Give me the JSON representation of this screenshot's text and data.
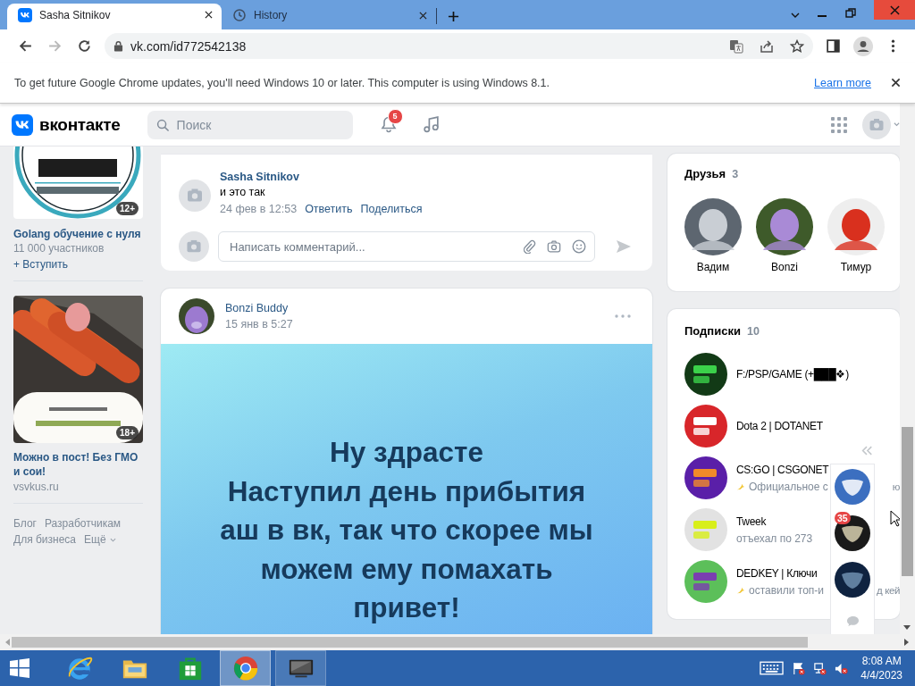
{
  "browser": {
    "tabs": [
      {
        "title": "Sasha Sitnikov",
        "selected": true
      },
      {
        "title": "History",
        "selected": false
      }
    ],
    "forward_disabled": true,
    "url": "vk.com/id772542138"
  },
  "infobar": {
    "message": "To get future Google Chrome updates, you'll need Windows 10 or later. This computer is using Windows 8.1.",
    "link": "Learn more"
  },
  "vk_header": {
    "logo": "вконтакте",
    "search": {
      "placeholder": "Поиск"
    },
    "notifications_badge": "5"
  },
  "left": {
    "group": {
      "age": "12+",
      "name": "Golang обучение с нуля",
      "members": "11 000 участников",
      "join": "+ Вступить"
    },
    "ad": {
      "age": "18+",
      "title": "Можно в пост! Без ГМО и сои!",
      "domain": "vsvkus.ru"
    },
    "footer_links": [
      "Блог",
      "Разработчикам",
      "Для бизнеса",
      "Ещё"
    ]
  },
  "comment": {
    "author": "Sasha Sitnikov",
    "text": "и это так",
    "date": "24 фев в 12:53",
    "actions": [
      "Ответить",
      "Поделиться"
    ]
  },
  "comment_input": {
    "placeholder": "Написать комментарий..."
  },
  "post": {
    "author": "Bonzi Buddy",
    "date": "15 янв в 5:27",
    "text": "Ну здрасте\nНаступил день прибытия\nаш в вк, так что скорее мы\nможем ему помахать\nпривет!"
  },
  "friends": {
    "title": "Друзья",
    "count": "3",
    "items": [
      {
        "name": "Вадим"
      },
      {
        "name": "Bonzi"
      },
      {
        "name": "Тимур"
      }
    ]
  },
  "subscriptions": {
    "title": "Подписки",
    "count": "10",
    "items": [
      {
        "name": "F:/PSP/GAME (+███❖)"
      },
      {
        "name": "Dota 2 | DOTANET"
      },
      {
        "name": "CS:GO | CSGONET",
        "status": "Официальное с",
        "status_tail": "ю",
        "emoji": true
      },
      {
        "name": "Tweek",
        "status": "отъехал по 273",
        "emoji": false
      },
      {
        "name": "DEDKEY | Ключи",
        "status": "оставили топ-и",
        "status_tail": "д кей",
        "emoji": true
      }
    ]
  },
  "messenger": {
    "items": [
      {
        "unread": false
      },
      {
        "unread": true,
        "badge": "35"
      },
      {
        "unread": false
      }
    ]
  },
  "taskbar": {
    "apps": [
      {
        "kind": "ie",
        "selected": false,
        "running": false
      },
      {
        "kind": "explorer",
        "selected": false,
        "running": false
      },
      {
        "kind": "store",
        "selected": false,
        "running": false
      },
      {
        "kind": "chrome",
        "selected": true,
        "running": true
      },
      {
        "kind": "screen",
        "selected": false,
        "running": true
      }
    ],
    "time": "8:08 AM",
    "date": "4/4/2023"
  }
}
